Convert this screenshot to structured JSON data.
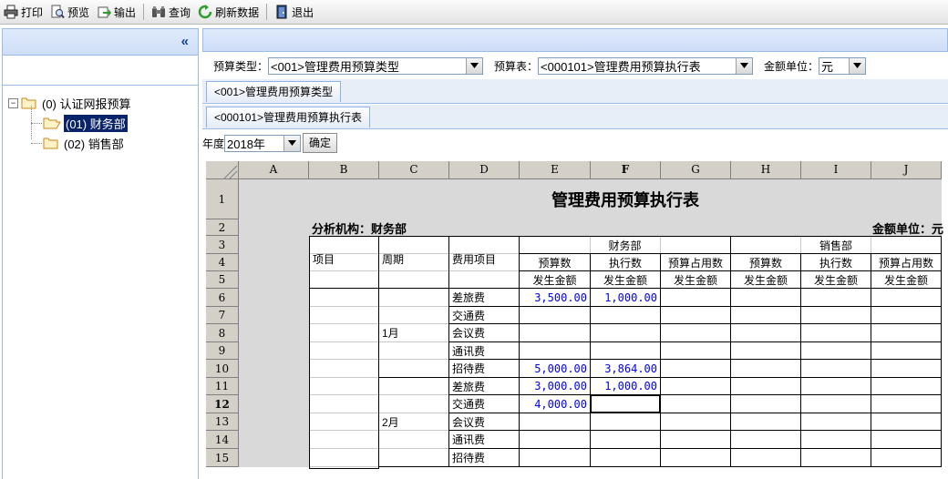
{
  "toolbar": {
    "print": "打印",
    "preview": "预览",
    "export": "输出",
    "query": "查询",
    "refresh": "刷新数据",
    "exit": "退出"
  },
  "left_panel": {
    "collapse": "«",
    "tree": {
      "root": "(0) 认证网报预算",
      "children": [
        "(01) 财务部",
        "(02) 销售部"
      ]
    }
  },
  "filters": {
    "budget_type_label": "预算类型：",
    "budget_type_value": "<001>管理费用预算类型",
    "budget_table_label": "预算表：",
    "budget_table_value": "<000101>管理费用预算执行表",
    "unit_label": "金额单位：",
    "unit_value": "元"
  },
  "tabs": {
    "type_tab": "<001>管理费用预算类型",
    "table_tab": "<000101>管理费用预算执行表"
  },
  "year": {
    "label": "年度",
    "value": "2018年",
    "confirm": "确定"
  },
  "sheet": {
    "columns": [
      "A",
      "B",
      "C",
      "D",
      "E",
      "F",
      "G",
      "H",
      "I",
      "J"
    ],
    "rows": [
      "1",
      "2",
      "3",
      "4",
      "5",
      "6",
      "7",
      "8",
      "9",
      "10",
      "11",
      "12",
      "13",
      "14",
      "15"
    ],
    "active_cell": "F12",
    "title": "管理费用预算执行表",
    "org_label": "分析机构：财务部",
    "amount_unit": "金额单位：元",
    "headers": {
      "item": "项目",
      "period": "周期",
      "expense_item": "费用项目",
      "dept1": "财务部",
      "dept2": "销售部",
      "budget": "预算数",
      "actual": "执行数",
      "ratio": "预算占用数",
      "amount": "发生金额"
    },
    "months": [
      "1月",
      "2月"
    ],
    "expenses": [
      "差旅费",
      "交通费",
      "会议费",
      "通讯费",
      "招待费"
    ],
    "values": {
      "r6_budget": "3,500.00",
      "r6_actual": "1,000.00",
      "r10_budget": "5,000.00",
      "r10_actual": "3,864.00",
      "r11_budget": "3,000.00",
      "r11_actual": "1,000.00",
      "r12_budget": "4,000.00"
    }
  }
}
